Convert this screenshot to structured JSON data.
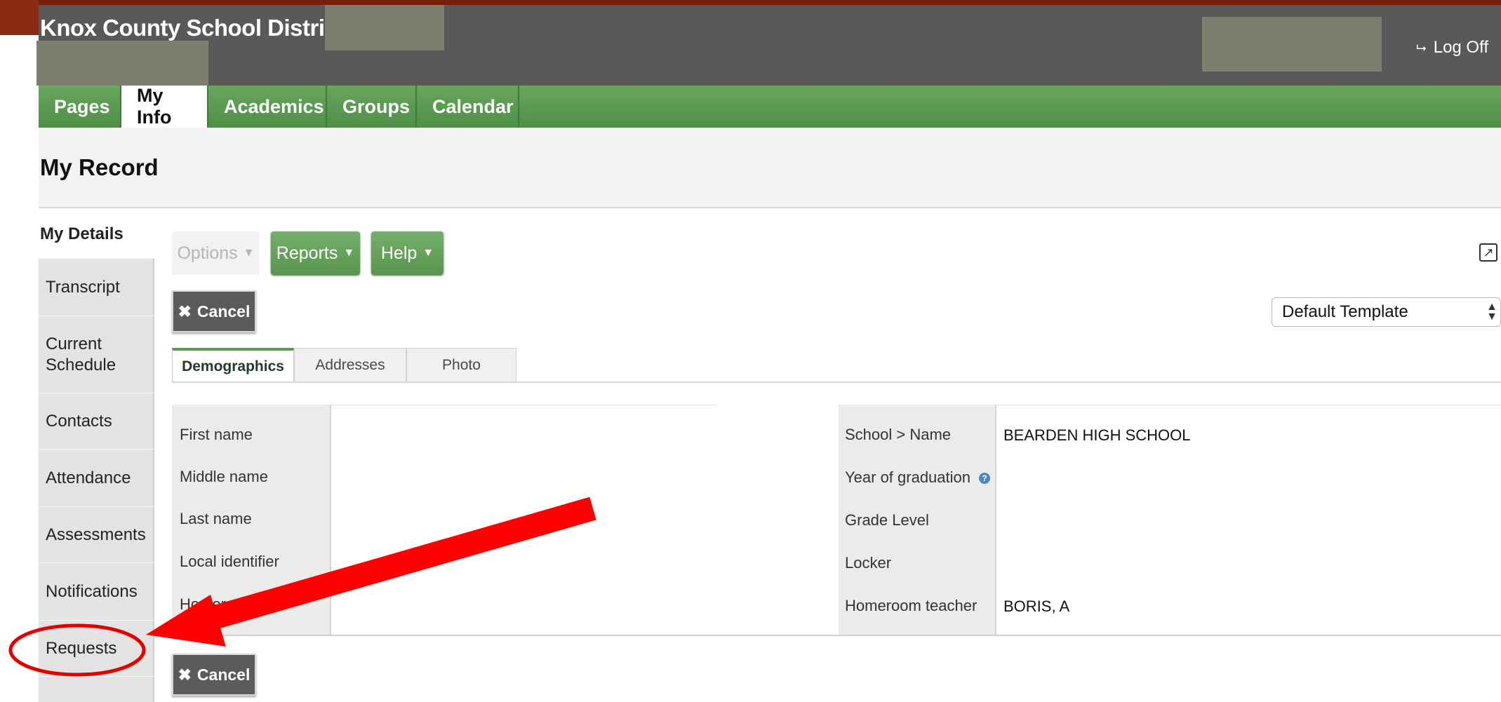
{
  "header": {
    "org_title": "Knox County School District",
    "logoff_label": "Log Off"
  },
  "nav": {
    "tabs": [
      {
        "label": "Pages",
        "active": false
      },
      {
        "label": "My Info",
        "active": true
      },
      {
        "label": "Academics",
        "active": false
      },
      {
        "label": "Groups",
        "active": false
      },
      {
        "label": "Calendar",
        "active": false
      }
    ]
  },
  "page": {
    "title": "My Record"
  },
  "sidebar": {
    "items": [
      {
        "label": "My Details",
        "active": true
      },
      {
        "label": "Transcript"
      },
      {
        "label": "Current Schedule"
      },
      {
        "label": "Contacts"
      },
      {
        "label": "Attendance"
      },
      {
        "label": "Assessments"
      },
      {
        "label": "Notifications"
      },
      {
        "label": "Requests"
      }
    ]
  },
  "toolbar": {
    "options_label": "Options",
    "reports_label": "Reports",
    "help_label": "Help",
    "cancel_label": "Cancel"
  },
  "template_select": {
    "value": "Default Template"
  },
  "subtabs": [
    {
      "label": "Demographics",
      "active": true
    },
    {
      "label": "Addresses"
    },
    {
      "label": "Photo"
    }
  ],
  "record": {
    "left_fields": [
      {
        "label": "First name",
        "value": ""
      },
      {
        "label": "Middle name",
        "value": ""
      },
      {
        "label": "Last name",
        "value": ""
      },
      {
        "label": "Local identifier",
        "value": ""
      },
      {
        "label": "Homeroom",
        "value": ""
      }
    ],
    "right_fields": [
      {
        "label": "School > Name",
        "value": "BEARDEN HIGH SCHOOL"
      },
      {
        "label": "Year of graduation",
        "value": ""
      },
      {
        "label": "Grade Level",
        "value": ""
      },
      {
        "label": "Locker",
        "value": ""
      },
      {
        "label": "Homeroom teacher",
        "value": "BORIS, A"
      }
    ]
  },
  "colors": {
    "header_bg": "#595959",
    "nav_green": "#5a9a50",
    "annotation_red": "#ff0000",
    "top_strip": "#7a1e0c"
  }
}
